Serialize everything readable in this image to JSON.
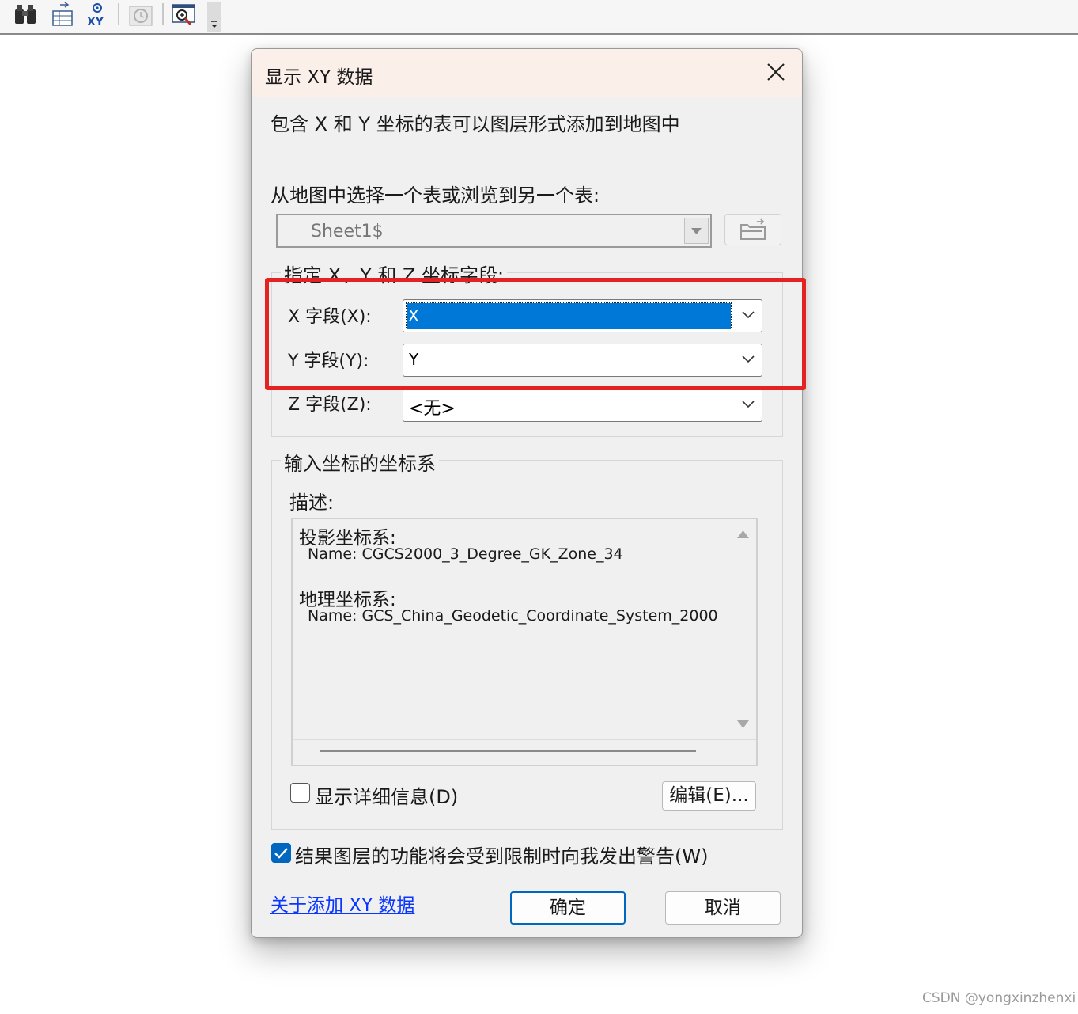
{
  "dialog": {
    "title": "显示 XY 数据",
    "intro": "包含 X 和 Y 坐标的表可以图层形式添加到地图中",
    "choose_table_label": "从地图中选择一个表或浏览到另一个表:",
    "table_value": "Sheet1$",
    "fields_group_label": "指定 X、Y 和 Z 坐标字段:",
    "x_field_label": "X 字段(X):",
    "x_field_value": "X",
    "y_field_label": "Y 字段(Y):",
    "y_field_value": "Y",
    "z_field_label": "Z 字段(Z):",
    "z_field_value": "<无>",
    "coord_group_label": "输入坐标的坐标系",
    "description_label": "描述:",
    "desc_projected_heading": "投影坐标系:",
    "desc_projected_name": "Name: CGCS2000_3_Degree_GK_Zone_34",
    "desc_geographic_heading": "地理坐标系:",
    "desc_geographic_name": "Name: GCS_China_Geodetic_Coordinate_System_2000",
    "show_details_label": "显示详细信息(D)",
    "show_details_checked": false,
    "edit_button": "编辑(E)...",
    "warn_label": "结果图层的功能将会受到限制时向我发出警告(W)",
    "warn_checked": true,
    "about_link": "关于添加 XY 数据",
    "ok_button": "确定",
    "cancel_button": "取消"
  },
  "toolbar": {
    "icons": [
      "binoculars-icon",
      "add-table-icon",
      "add-xy-data-icon",
      "time-slider-icon",
      "zoom-window-icon",
      "toolbar-overflow-icon"
    ]
  },
  "colors": {
    "highlight": "#e52222",
    "selection": "#0078d7",
    "link": "#0a36ff",
    "checkbox_checked": "#0067c0"
  },
  "watermark": "CSDN @yongxinzhenxi"
}
